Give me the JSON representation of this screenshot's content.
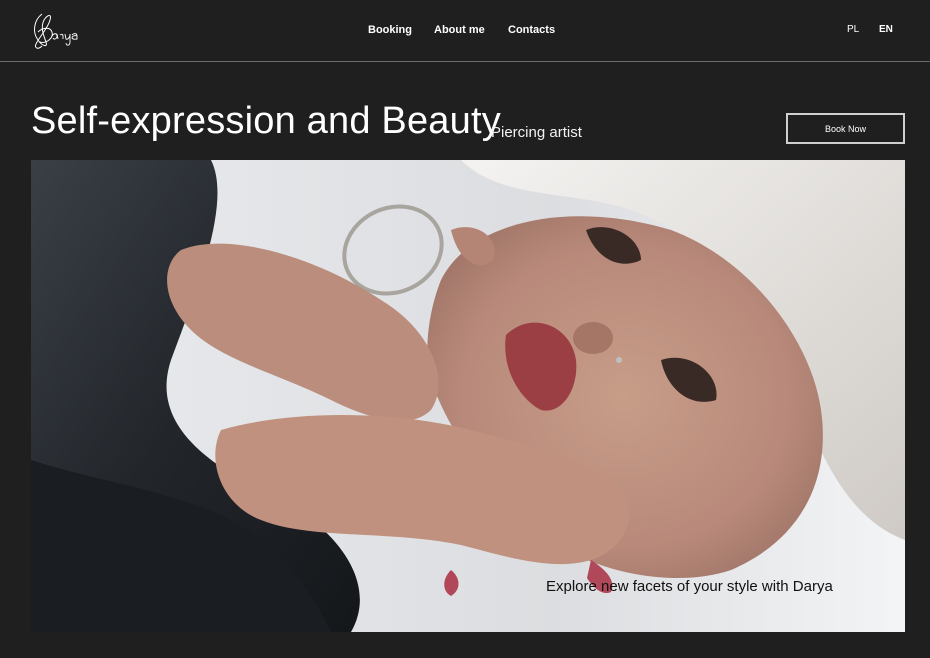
{
  "header": {
    "logo_text": "Darya",
    "nav": [
      "Booking",
      "About me",
      "Contacts"
    ],
    "languages": [
      "PL",
      "EN"
    ],
    "active_language": "EN"
  },
  "hero": {
    "title": "Self-expression and Beauty",
    "subtitle": "Piercing artist",
    "cta_label": "Book Now",
    "caption": "Explore new facets of your style with Darya"
  },
  "colors": {
    "background": "#1f1f1f",
    "text": "#ffffff",
    "divider": "#6b6b6b"
  }
}
